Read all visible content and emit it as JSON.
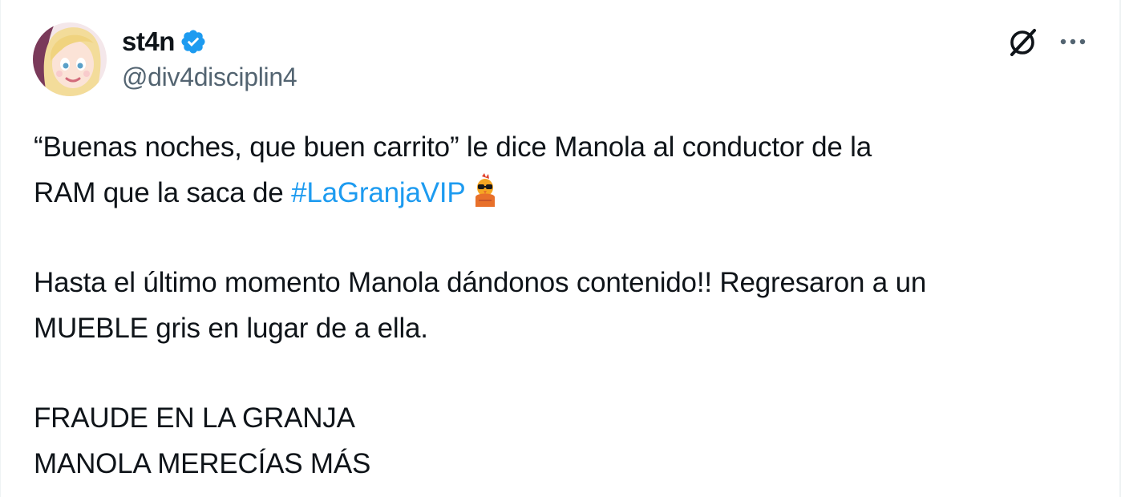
{
  "author": {
    "display_name": "st4n",
    "handle": "@div4disciplin4",
    "verified": true,
    "avatar_icon": "cartoon-blonde-girl-avatar"
  },
  "actions": {
    "grok_icon": "grok-icon",
    "more_icon": "more-dots-icon"
  },
  "tweet": {
    "line1": "“Buenas noches, que buen carrito” le dice Manola al conductor de la",
    "line2_prefix": "RAM que la saca de ",
    "hashtag": "#LaGranjaVIP",
    "hashtag_emoji_icon": "hashtag-rooster-emoji-icon",
    "line3": "Hasta el último momento Manola dándonos contenido!! Regresaron a un",
    "line4": "MUEBLE gris en lugar de a ella.",
    "line5": "FRAUDE EN LA GRANJA",
    "line6": "MANOLA MERECÍAS MÁS"
  },
  "colors": {
    "link": "#1d9bf0",
    "text": "#0f1419",
    "secondary": "#536471",
    "verified": "#1d9bf0"
  }
}
